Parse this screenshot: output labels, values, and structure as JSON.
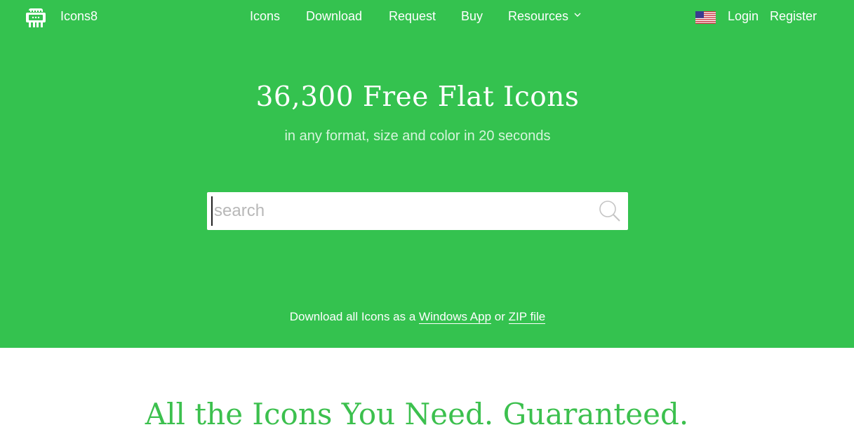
{
  "brand": {
    "name": "Icons8",
    "icon": "icons8-logo-icon"
  },
  "nav": {
    "items": [
      {
        "label": "Icons"
      },
      {
        "label": "Download"
      },
      {
        "label": "Request"
      },
      {
        "label": "Buy"
      },
      {
        "label": "Resources"
      }
    ],
    "login": "Login",
    "register": "Register",
    "language_icon": "us-flag-icon"
  },
  "hero": {
    "title": "36,300 Free Flat Icons",
    "subtitle": "in any format, size and color in 20 seconds",
    "search": {
      "placeholder": "search",
      "value": "",
      "icon": "search-icon"
    },
    "download_prefix": "Download all Icons as a",
    "download_app": "Windows App",
    "download_or": "or",
    "download_zip": "ZIP file"
  },
  "tagline": "All the Icons You Need. Guaranteed.",
  "colors": {
    "brand_green": "#34c24f",
    "tagline_green": "#3cc04e"
  }
}
